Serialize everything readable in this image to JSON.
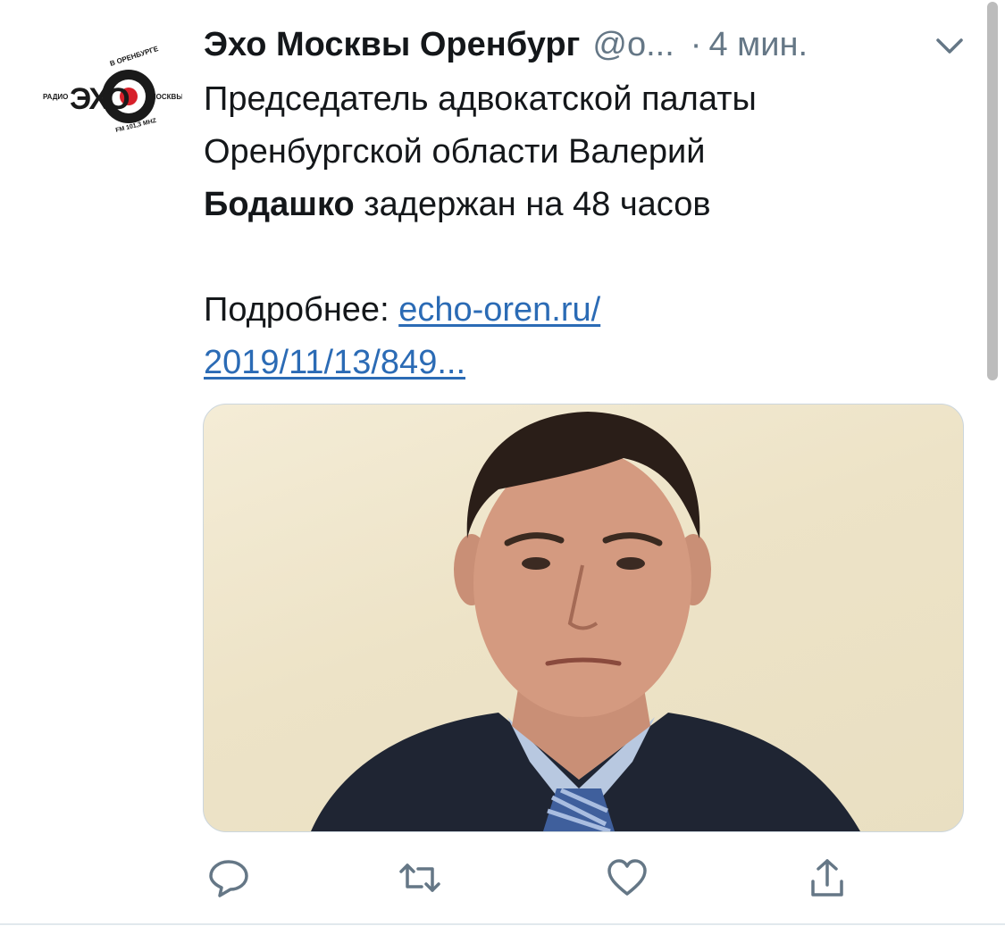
{
  "tweet": {
    "author_name": "Эхо Москвы Оренбург",
    "handle": "@o...",
    "separator": "·",
    "time": "4 мин.",
    "text_line1": "Председатель адвокатской палаты",
    "text_line2": "Оренбургской области Валерий",
    "text_bold": "Бодашко",
    "text_rest": " задержан на 48 часов",
    "more_label": "Подробнее: ",
    "link_line1": "echo-oren.ru/",
    "link_line2": "2019/11/13/849..."
  },
  "avatar": {
    "logo_main": "ЭХО",
    "logo_radio": "РАДИО",
    "logo_moskvy": "МОСКВЫ",
    "logo_city": "В ОРЕНБУРГЕ",
    "logo_freq": "FM 101,3 MHZ"
  },
  "icons": {
    "caret": "chevron-down-icon",
    "reply": "reply-icon",
    "retweet": "retweet-icon",
    "like": "heart-icon",
    "share": "share-icon"
  },
  "colors": {
    "text": "#14171a",
    "muted": "#657786",
    "link": "#2b6bb5",
    "divider": "#e1e8ed",
    "logo_red": "#d7202a"
  }
}
